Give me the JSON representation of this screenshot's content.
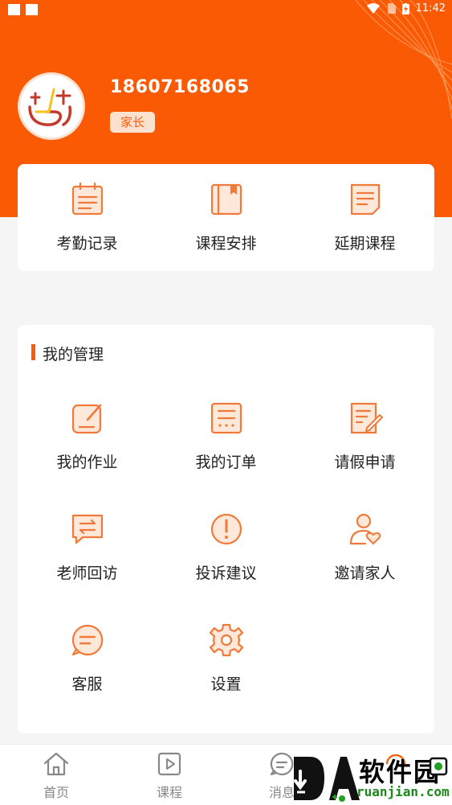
{
  "status_bar": {
    "time": "11:42"
  },
  "profile": {
    "phone": "18607168065",
    "role": "家长"
  },
  "quick_actions": [
    {
      "label": "考勤记录",
      "icon": "calendar-icon"
    },
    {
      "label": "课程安排",
      "icon": "book-icon"
    },
    {
      "label": "延期课程",
      "icon": "document-icon"
    }
  ],
  "management": {
    "title": "我的管理",
    "items": [
      {
        "label": "我的作业",
        "icon": "edit-icon"
      },
      {
        "label": "我的订单",
        "icon": "order-icon"
      },
      {
        "label": "请假申请",
        "icon": "leave-form-icon"
      },
      {
        "label": "老师回访",
        "icon": "chat-exchange-icon"
      },
      {
        "label": "投诉建议",
        "icon": "exclamation-icon"
      },
      {
        "label": "邀请家人",
        "icon": "invite-user-icon"
      },
      {
        "label": "客服",
        "icon": "customer-service-icon"
      },
      {
        "label": "设置",
        "icon": "gear-icon"
      }
    ]
  },
  "tabbar": [
    {
      "label": "首页",
      "icon": "home-icon"
    },
    {
      "label": "课程",
      "icon": "course-play-icon"
    },
    {
      "label": "消息",
      "icon": "message-icon"
    }
  ],
  "watermark": {
    "brand": "软件园",
    "domain": "ruanjian.com"
  },
  "colors": {
    "accent": "#fb5a04",
    "badge_bg": "#fde1cf",
    "page_bg": "#f5f5f5"
  }
}
